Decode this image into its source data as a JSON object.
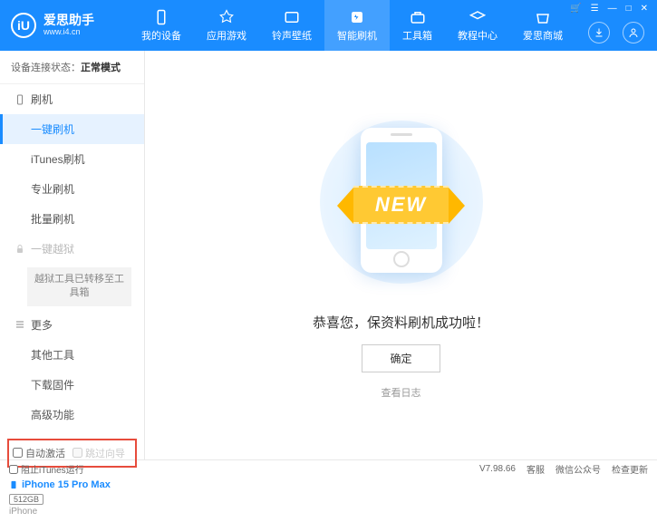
{
  "header": {
    "logo_letter": "iU",
    "app_name": "爱思助手",
    "url": "www.i4.cn",
    "tabs": [
      {
        "label": "我的设备"
      },
      {
        "label": "应用游戏"
      },
      {
        "label": "铃声壁纸"
      },
      {
        "label": "智能刷机"
      },
      {
        "label": "工具箱"
      },
      {
        "label": "教程中心"
      },
      {
        "label": "爱思商城"
      }
    ],
    "win_controls": {
      "cart": "🛒",
      "menu": "☰",
      "min": "—",
      "max": "□",
      "close": "✕"
    }
  },
  "sidebar": {
    "conn_label": "设备连接状态：",
    "conn_mode": "正常模式",
    "sec_flash": "刷机",
    "items_flash": [
      "一键刷机",
      "iTunes刷机",
      "专业刷机",
      "批量刷机"
    ],
    "sec_jailbreak": "一键越狱",
    "jailbreak_note": "越狱工具已转移至工具箱",
    "sec_more": "更多",
    "items_more": [
      "其他工具",
      "下载固件",
      "高级功能"
    ],
    "cb_auto_activate": "自动激活",
    "cb_skip_guide": "跳过向导",
    "device_name": "iPhone 15 Pro Max",
    "storage": "512GB",
    "device_type": "iPhone"
  },
  "main": {
    "ribbon_text": "NEW",
    "success_msg": "恭喜您，保资料刷机成功啦！",
    "ok_btn": "确定",
    "view_log": "查看日志"
  },
  "footer": {
    "block_itunes": "阻止iTunes运行",
    "version": "V7.98.66",
    "links": [
      "客服",
      "微信公众号",
      "检查更新"
    ]
  }
}
